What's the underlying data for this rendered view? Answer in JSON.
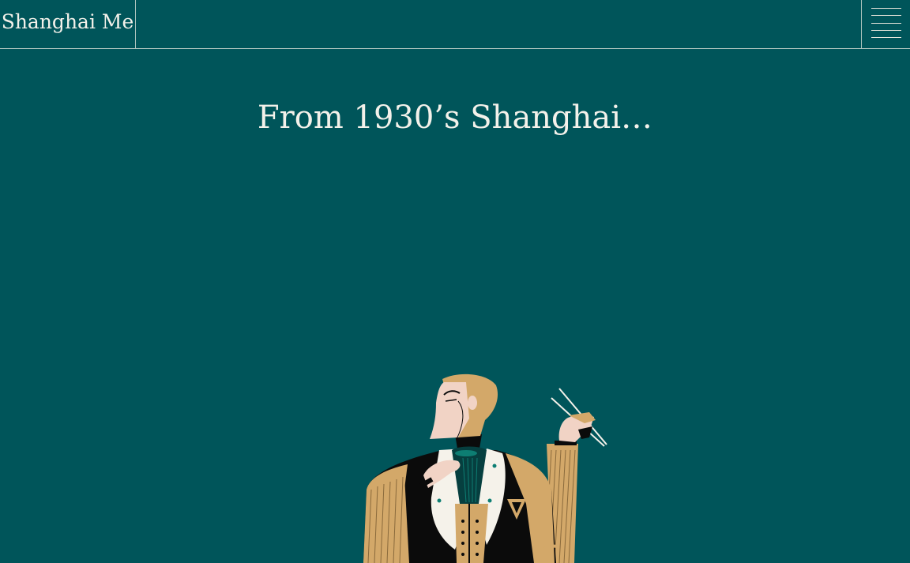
{
  "header": {
    "brand": "Shanghai Me",
    "menu_icon": "hamburger-icon"
  },
  "hero": {
    "headline": "From 1930’s Shanghai…"
  },
  "illustration": {
    "subject": "art-deco-gentleman-with-chopsticks",
    "colors": {
      "background": "#00555a",
      "gold": "#d3a869",
      "skin": "#f1d3c5",
      "black": "#0b0b0b",
      "white": "#f5f2ea",
      "teal": "#0d7e73"
    }
  }
}
